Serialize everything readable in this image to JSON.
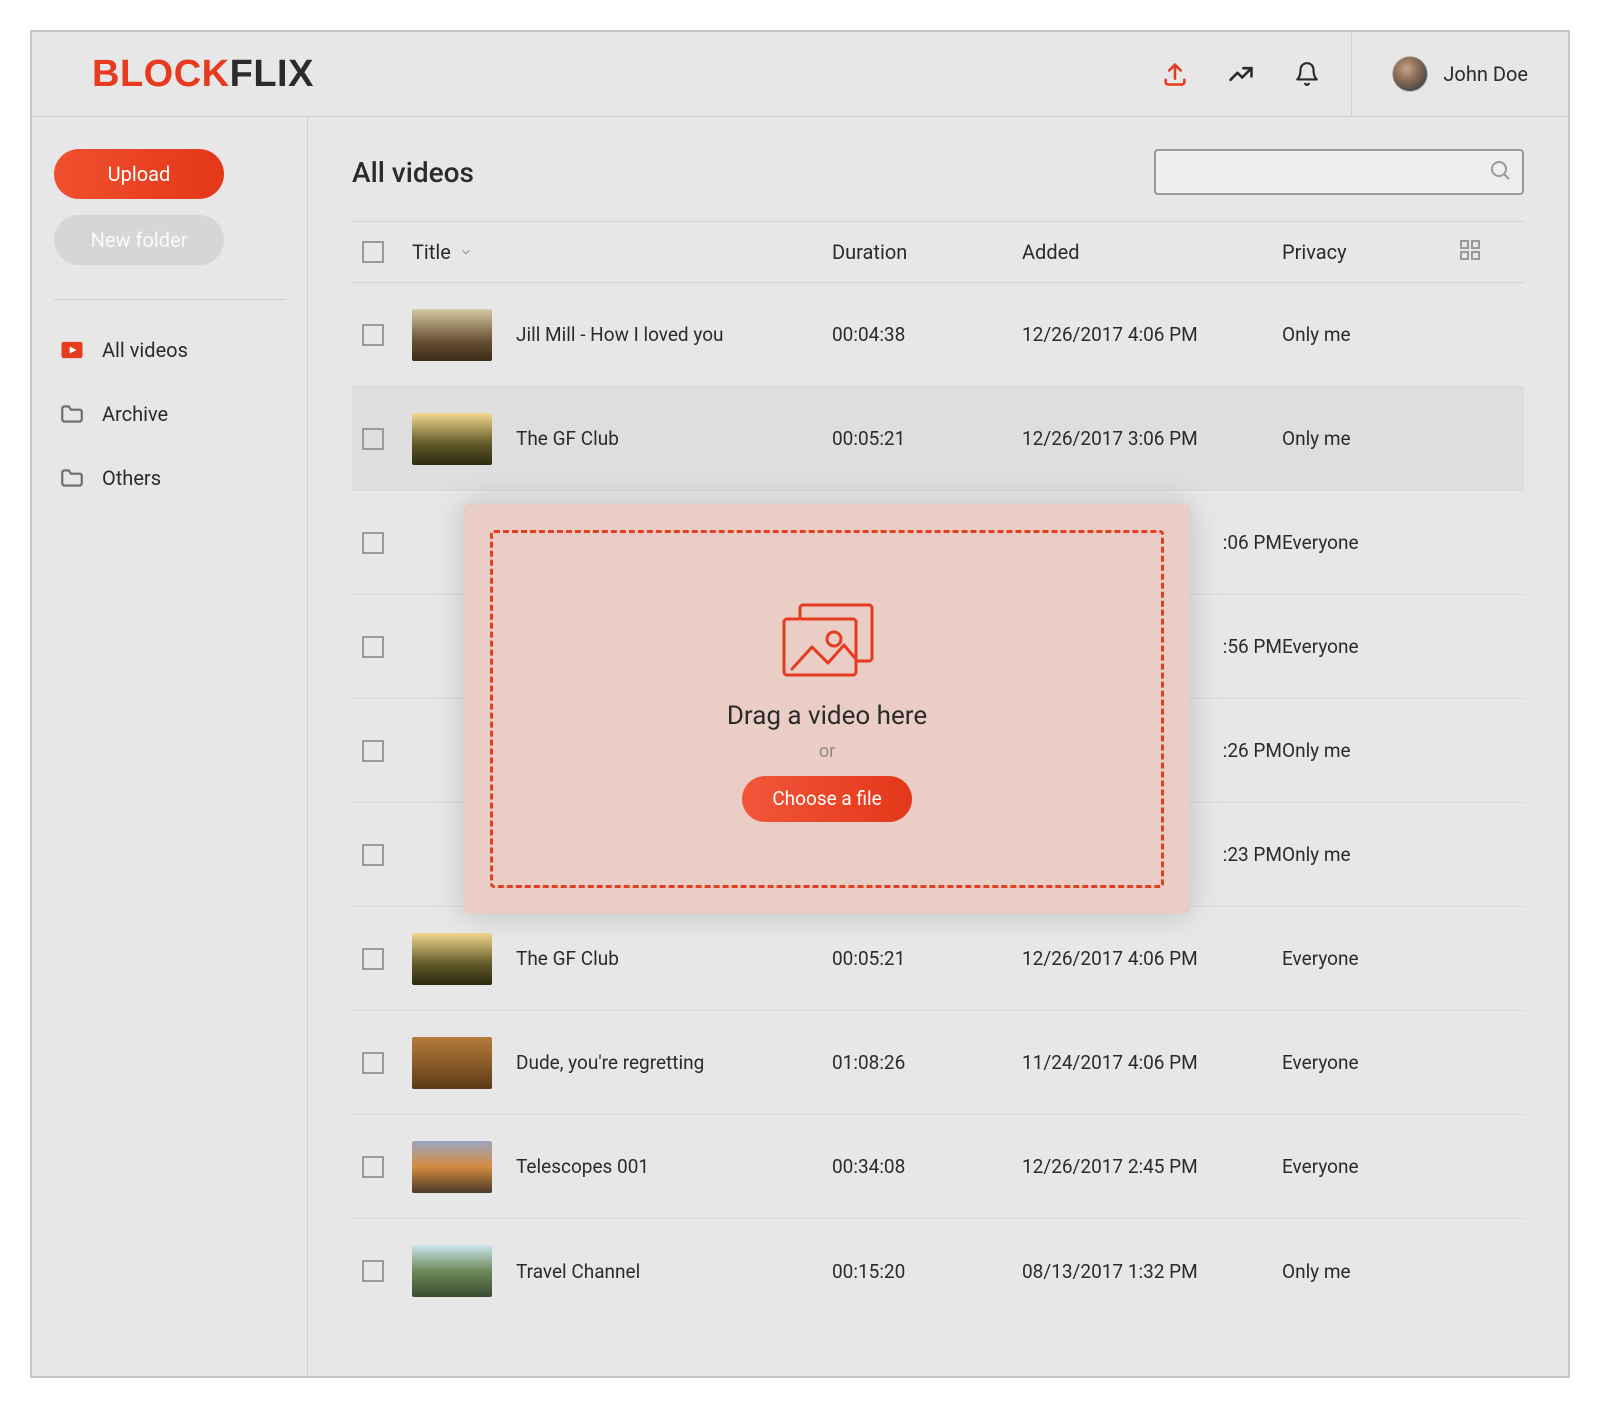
{
  "brand": {
    "part1": "BLOCK",
    "part2": "FLIX"
  },
  "user": {
    "name": "John Doe"
  },
  "sidebar": {
    "upload": "Upload",
    "new_folder": "New folder",
    "items": [
      {
        "label": "All videos"
      },
      {
        "label": "Archive"
      },
      {
        "label": "Others"
      }
    ]
  },
  "page": {
    "title": "All videos"
  },
  "columns": {
    "title": "Title",
    "duration": "Duration",
    "added": "Added",
    "privacy": "Privacy"
  },
  "rows": [
    {
      "title": "Jill Mill - How I loved you",
      "duration": "00:04:38",
      "added": "12/26/2017 4:06 PM",
      "privacy": "Only me",
      "thumb": "t1"
    },
    {
      "title": "The GF Club",
      "duration": "00:05:21",
      "added": "12/26/2017 3:06 PM",
      "privacy": "Only me",
      "thumb": "t2",
      "hovered": true
    },
    {
      "title": "",
      "duration": "",
      "added": ":06 PM",
      "privacy": "Everyone",
      "thumb": "",
      "obscured": true
    },
    {
      "title": "",
      "duration": "",
      "added": ":56 PM",
      "privacy": "Everyone",
      "thumb": "",
      "obscured": true
    },
    {
      "title": "",
      "duration": "",
      "added": ":26 PM",
      "privacy": "Only me",
      "thumb": "",
      "obscured": true
    },
    {
      "title": "",
      "duration": "",
      "added": ":23 PM",
      "privacy": "Only me",
      "thumb": "",
      "obscured": true
    },
    {
      "title": "The GF Club",
      "duration": "00:05:21",
      "added": "12/26/2017 4:06 PM",
      "privacy": "Everyone",
      "thumb": "t2"
    },
    {
      "title": "Dude, you're regretting",
      "duration": "01:08:26",
      "added": "11/24/2017 4:06 PM",
      "privacy": "Everyone",
      "thumb": "t3"
    },
    {
      "title": "Telescopes 001",
      "duration": "00:34:08",
      "added": "12/26/2017 2:45 PM",
      "privacy": "Everyone",
      "thumb": "t5"
    },
    {
      "title": "Travel Channel",
      "duration": "00:15:20",
      "added": "08/13/2017 1:32 PM",
      "privacy": "Only me",
      "thumb": "t6"
    }
  ],
  "modal": {
    "drag_text": "Drag a video here",
    "or": "or",
    "choose": "Choose a file"
  }
}
